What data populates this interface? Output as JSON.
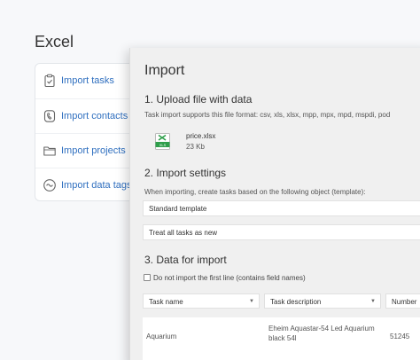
{
  "page": {
    "title": "Excel"
  },
  "sidebar": {
    "items": [
      {
        "label": "Import tasks",
        "icon": "clipboard-check-icon"
      },
      {
        "label": "Import contacts",
        "icon": "contacts-icon"
      },
      {
        "label": "Import projects",
        "icon": "folder-icon"
      },
      {
        "label": "Import data tags",
        "icon": "tag-icon"
      }
    ]
  },
  "dialog": {
    "title": "Import",
    "upload": {
      "heading": "1. Upload file with data",
      "hint": "Task import supports this file format: csv, xls, xlsx, mpp, mpx, mpd, mspdi, pod",
      "file_icon_text": "XLS",
      "file_name": "price.xlsx",
      "file_size": "23 Kb"
    },
    "settings": {
      "heading": "2. Import settings",
      "hint": "When importing, create tasks based on the following object (template):",
      "template_value": "Standard template",
      "status_value": "Treat all tasks as new"
    },
    "data": {
      "heading": "3. Data for import",
      "checkbox_label": "Do not import the first line (contains field names)",
      "columns": [
        "Task name",
        "Task description",
        "Number"
      ],
      "rows": [
        {
          "name": "Aquarium",
          "description": "Eheim Aquastar-54 Led Aquarium black 54l",
          "number": "51245"
        }
      ]
    }
  },
  "colors": {
    "accent": "#2f6fbf",
    "dialog_bg": "#f0f0f0",
    "xls_green": "#2e9e4a"
  }
}
